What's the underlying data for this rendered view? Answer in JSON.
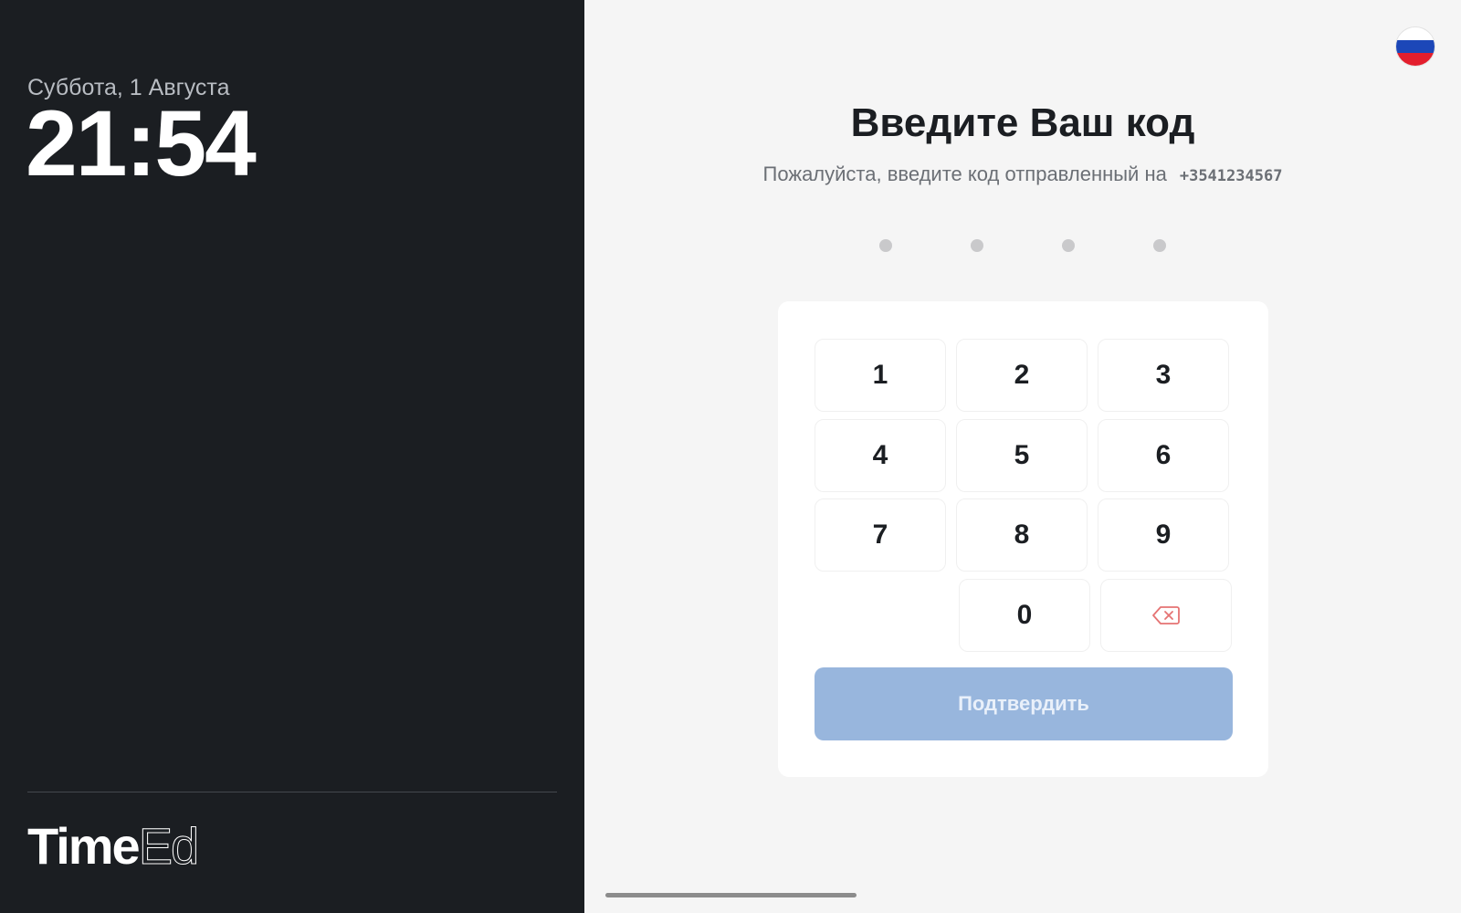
{
  "left": {
    "date": "Суббота, 1 Августа",
    "time": "21:54",
    "logo_bold": "Time",
    "logo_light": "Ed"
  },
  "header": {
    "language_flag": "ru-flag-icon",
    "title": "Введите Ваш код",
    "subtitle": "Пожалуйста, введите код отправленный на",
    "phone": "+3541234567"
  },
  "code": {
    "entered_digits": 0,
    "total_digits": 4
  },
  "keypad": {
    "keys": [
      "1",
      "2",
      "3",
      "4",
      "5",
      "6",
      "7",
      "8",
      "9",
      "0"
    ],
    "delete_icon": "backspace-icon"
  },
  "actions": {
    "confirm_label": "Подтвердить"
  },
  "colors": {
    "left_panel_bg": "#1b1e22",
    "confirm_button_disabled": "#98b6dd",
    "delete_icon": "#e57373"
  }
}
